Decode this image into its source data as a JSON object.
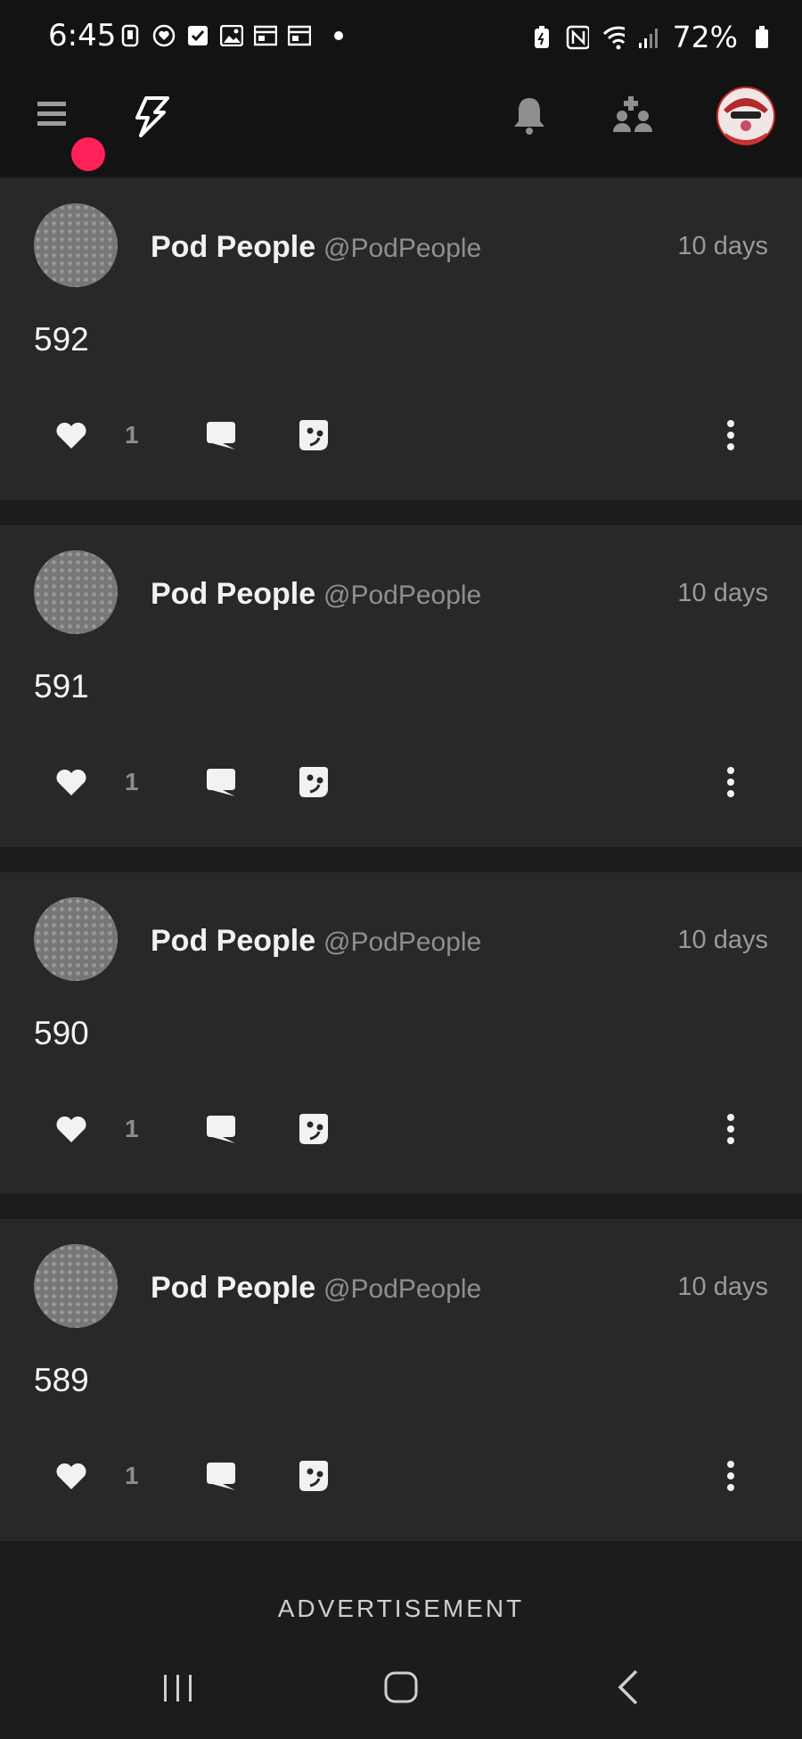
{
  "status_bar": {
    "time": "6:45",
    "battery_percent": "72%"
  },
  "header": {
    "menu_icon": "hamburger-menu-icon",
    "logo_icon": "lightning-logo-icon",
    "notifications_icon": "bell-icon",
    "people_icon": "add-people-icon",
    "notification_badge_color": "#ff2158"
  },
  "posts": [
    {
      "author": "Pod People",
      "handle": "@PodPeople",
      "time": "10 days",
      "body": "592",
      "likes": "1"
    },
    {
      "author": "Pod People",
      "handle": "@PodPeople",
      "time": "10 days",
      "body": "591",
      "likes": "1"
    },
    {
      "author": "Pod People",
      "handle": "@PodPeople",
      "time": "10 days",
      "body": "590",
      "likes": "1"
    },
    {
      "author": "Pod People",
      "handle": "@PodPeople",
      "time": "10 days",
      "body": "589",
      "likes": "1"
    }
  ],
  "footer": {
    "advertisement_label": "ADVERTISEMENT"
  },
  "colors": {
    "background": "#1c1c1c",
    "card": "#282828",
    "accent": "#ff2158"
  }
}
